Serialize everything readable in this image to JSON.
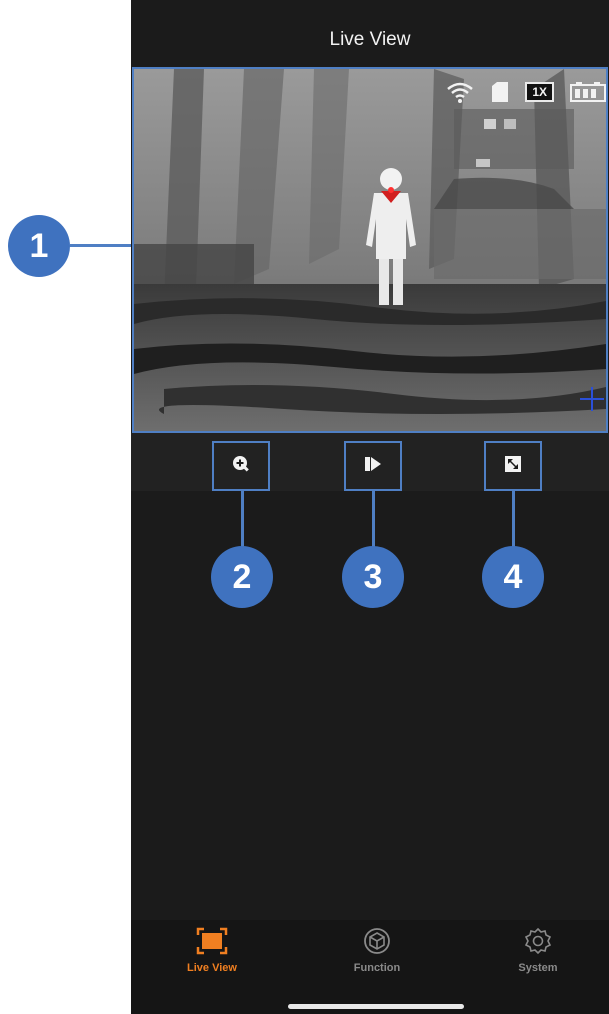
{
  "header": {
    "title": "Live View"
  },
  "viewport": {
    "overlay": {
      "icons": [
        "wifi-icon",
        "sd-card-icon",
        "battery-icon"
      ],
      "zoom_label": "1X"
    },
    "crosshair_color": "#2b50d8"
  },
  "controls": [
    {
      "icon": "zoom-in-icon"
    },
    {
      "icon": "palette-icon"
    },
    {
      "icon": "fullscreen-icon"
    }
  ],
  "callouts": [
    "1",
    "2",
    "3",
    "4"
  ],
  "tabs": [
    {
      "label": "Live View",
      "icon": "live-view-icon",
      "active": true
    },
    {
      "label": "Function",
      "icon": "function-icon",
      "active": false
    },
    {
      "label": "System",
      "icon": "gear-icon",
      "active": false
    }
  ],
  "colors": {
    "accent": "#f07f21",
    "callout": "#3f72bf",
    "frame": "#4f7fc4"
  }
}
